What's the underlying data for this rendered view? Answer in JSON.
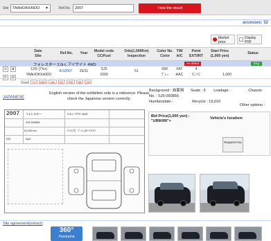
{
  "topbar": {
    "site_label": "Site",
    "site_value": "TAAHOKKAIDO",
    "ref_label": "Ref.No.",
    "ref_value": "2007",
    "view_button": "View the result"
  },
  "accesses": "accesses: 52",
  "tools": {
    "market_price": "Market price",
    "display_pdf": "Display PDF"
  },
  "table": {
    "headers": [
      "Date\nSite",
      "Ref.No.",
      "Year",
      "Model code\nCC/Fuel",
      "Odo(1,000Km)\nInspection",
      "Color No.\nColor",
      "T/M\nA/C",
      "Point\nEXT/INT",
      "Start Price\n(1,000 yen)",
      "Status"
    ],
    "title": "フォレスター 2.0i-L アイサイト 4WD",
    "aa_badge": "AA debut",
    "status_badge": "Eng",
    "row": {
      "date": "12/5 (Thu)",
      "site": "TAAHOKKAIDO",
      "ref": "A 02007",
      "year": "26/11",
      "model": "SJ5",
      "cc": "2000",
      "odo": "51",
      "color_no": "65K",
      "color": "ｸﾞﾚｰ",
      "tm": "FAT",
      "ac": "AAC",
      "point": "4",
      "ext_int": "C / C",
      "start_price": "1,000"
    },
    "side_buttons": [
      "A",
      "B",
      "C",
      "D"
    ],
    "tags": [
      "Good",
      "TV",
      "ABS",
      "AW",
      "PS",
      "PW",
      "AB",
      "SR"
    ]
  },
  "japanese_link": "JAPANESE",
  "note": "English version of the exhibition vote is a reference. Please check the Japanese version correctly.",
  "sheet": {
    "year": "2007",
    "car_name": "フォレスター",
    "grade": "2.0i-L ｱｲｻｲﾄ 4WD",
    "plate": "SJ5-090856",
    "odo": "51,000 km",
    "fat": "FAT",
    "aac": "AAC",
    "features": "ｷｰﾚｽ ﾅﾋﾞ ﾌﾟｯｼｭｽﾀｰﾄ ETC"
  },
  "info": {
    "background": "Background : 自家用",
    "seats": "Seats :  5",
    "loadage": "Loadage :",
    "chassis": "Chassis",
    "no": "No. : SJ5-090856",
    "numberplate": "Numberplate :",
    "recycle": "Recycle :  13,010",
    "other_options": "Other options :"
  },
  "bid": {
    "label": "Bid Price(1,000 yen) :",
    "value": "\"URIKIRI\"+",
    "vehicle_location": "Vehicle's location:",
    "request_button": "Request Fax"
  },
  "site_agreement": "Site agreement(extract)",
  "panorama": {
    "number": "360°",
    "label": "Panorama"
  },
  "colors": {
    "accent_red": "#d9141c",
    "link_blue": "#2a4fa7",
    "status_green": "#29a33a",
    "title_row": "#c8d6f2"
  }
}
